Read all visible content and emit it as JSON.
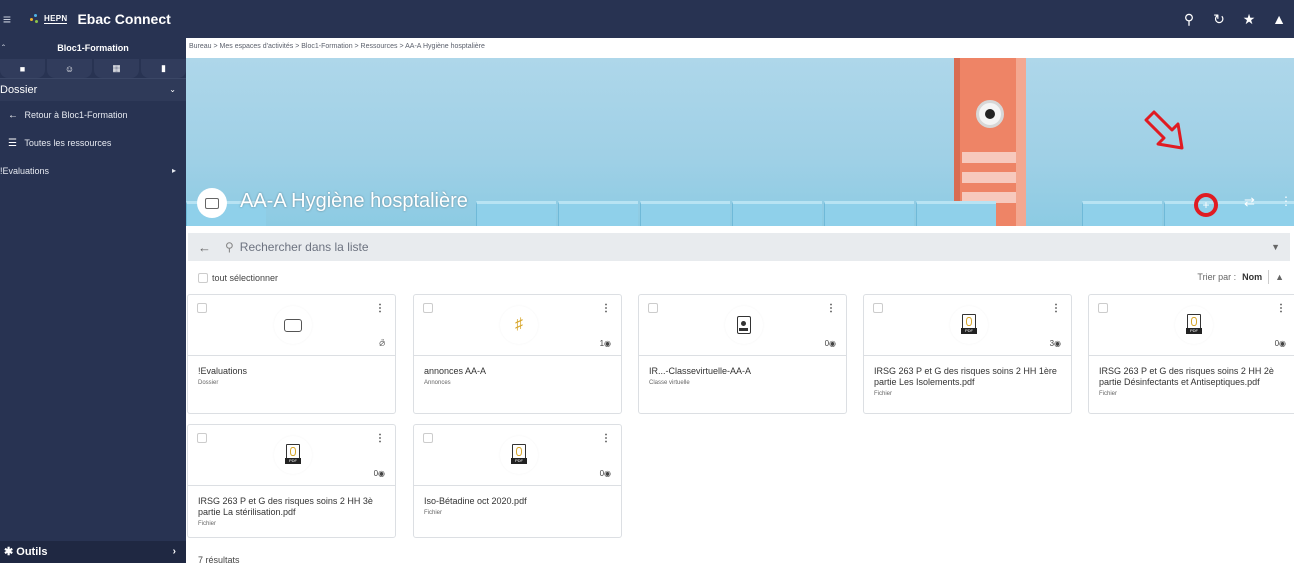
{
  "app": {
    "title": "Ebac Connect",
    "logo_text": "HEPN"
  },
  "topbar": {
    "icons": [
      "search-icon",
      "history-icon",
      "star-icon",
      "bell-icon"
    ]
  },
  "sidebar": {
    "header": "Bloc1-Formation",
    "tabs": [
      "folder-icon",
      "users-icon",
      "calendar-icon",
      "trash-icon"
    ],
    "section": "Dossier",
    "items": [
      {
        "label": "Retour à Bloc1-Formation",
        "icon": "arrow-left-icon"
      },
      {
        "label": "Toutes les ressources",
        "icon": "list-icon"
      },
      {
        "label": "!Evaluations",
        "icon": ""
      }
    ],
    "footer": "Outils"
  },
  "breadcrumb": "Bureau > Mes espaces d'activités > Bloc1-Formation > Ressources > AA-A Hygiène hosptalière",
  "banner": {
    "title": "AA-A Hygiène hosptalière",
    "annotation_color": "#e01b22"
  },
  "search": {
    "placeholder": "Rechercher dans la liste"
  },
  "list": {
    "select_all": "tout sélectionner",
    "sort_label": "Trier par :",
    "sort_value": "Nom",
    "results": "7 résultats",
    "cards": [
      {
        "name": "!Evaluations",
        "type": "Dossier",
        "views": "",
        "icon": "folder-icon"
      },
      {
        "name": "annonces AA-A",
        "type": "Annonces",
        "views": "1",
        "icon": "megaphone-icon"
      },
      {
        "name": "IR...-Classevirtuelle-AA-A",
        "type": "Classe virtuelle",
        "views": "0",
        "icon": "virtual-class-icon"
      },
      {
        "name": "IRSG 263 P et G des risques soins 2 HH 1ère partie Les Isolements.pdf",
        "type": "Fichier",
        "views": "3",
        "icon": "pdf-icon"
      },
      {
        "name": "IRSG 263 P et G des risques soins 2 HH 2è partie Désinfectants et Antiseptiques.pdf",
        "type": "Fichier",
        "views": "0",
        "icon": "pdf-icon"
      },
      {
        "name": "IRSG 263 P et G des risques soins 2 HH 3è partie La stérilisation.pdf",
        "type": "Fichier",
        "views": "0",
        "icon": "pdf-icon"
      },
      {
        "name": "Iso-Bétadine oct 2020.pdf",
        "type": "Fichier",
        "views": "0",
        "icon": "pdf-icon"
      }
    ]
  }
}
